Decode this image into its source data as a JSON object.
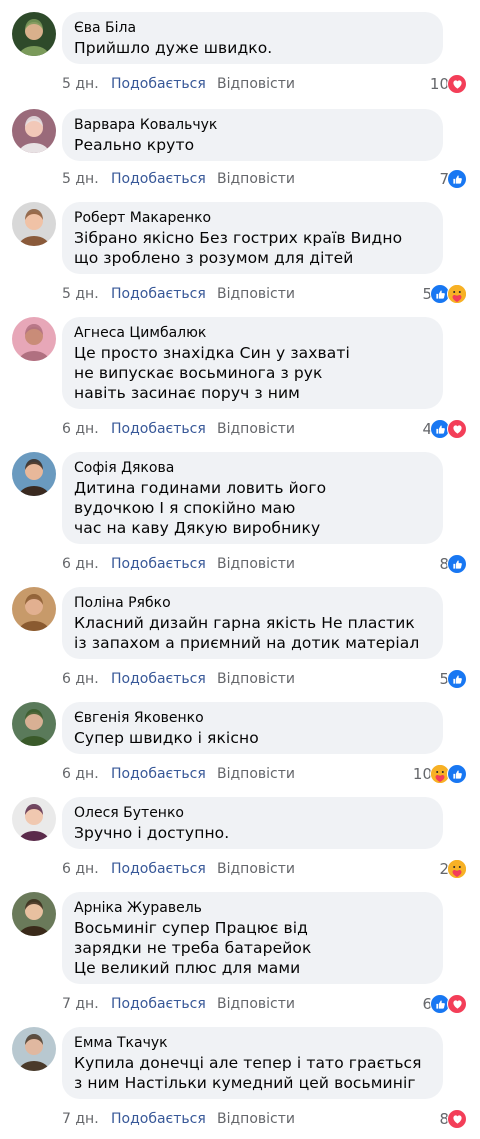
{
  "ui": {
    "like_label": "Подобається",
    "reply_label": "Відповісти"
  },
  "colors": {
    "like_blue": "#1877f2",
    "love_red": "#f33e58",
    "care_yellow": "#f7b125",
    "bubble_bg": "#f0f2f5",
    "meta_gray": "#65676b",
    "link_blue": "#385898"
  },
  "comments": [
    {
      "author": "Єва Біла",
      "lines": [
        "Прийшло дуже швидко."
      ],
      "time": "5 дн.",
      "count": "10",
      "reactions": [
        "love-icon"
      ]
    },
    {
      "author": "Варвара Ковальчук",
      "lines": [
        "Реально круто"
      ],
      "time": "5 дн.",
      "count": "7",
      "reactions": [
        "like-icon"
      ]
    },
    {
      "author": "Роберт Макаренко",
      "lines": [
        "Зібрано якісно Без гострих країв Видно",
        "що зроблено з розумом для дітей"
      ],
      "time": "5 дн.",
      "count": "5",
      "reactions": [
        "like-icon",
        "care-icon"
      ]
    },
    {
      "author": "Агнеса Цимбалюк",
      "lines": [
        "Це просто знахідка Син у захваті",
        "не випускає восьминога з рук",
        "навіть засинає поруч з ним"
      ],
      "time": "6 дн.",
      "count": "4",
      "reactions": [
        "like-icon",
        "love-icon"
      ]
    },
    {
      "author": "Софія Дякова",
      "lines": [
        "Дитина годинами ловить його",
        "вудочкою І я спокійно маю",
        "час на каву Дякую виробнику"
      ],
      "time": "6 дн.",
      "count": "8",
      "reactions": [
        "like-icon"
      ]
    },
    {
      "author": "Поліна Рябко",
      "lines": [
        "Класний дизайн гарна якість Не пластик",
        "із запахом а приємний на дотик матеріал"
      ],
      "time": "6 дн.",
      "count": "5",
      "reactions": [
        "like-icon"
      ]
    },
    {
      "author": "Євгенія Яковенко",
      "lines": [
        "Супер швидко і якісно"
      ],
      "time": "6 дн.",
      "count": "10",
      "reactions": [
        "care-icon",
        "like-icon"
      ]
    },
    {
      "author": "Олеся Бутенко",
      "lines": [
        "Зручно і доступно."
      ],
      "time": "6 дн.",
      "count": "2",
      "reactions": [
        "care-icon"
      ]
    },
    {
      "author": "Арніка Журавель",
      "lines": [
        "Восьминіг супер Працює від",
        "зарядки не треба батарейок",
        "Це великий плюс для мами"
      ],
      "time": "7 дн.",
      "count": "6",
      "reactions": [
        "like-icon",
        "love-icon"
      ]
    },
    {
      "author": "Емма Ткачук",
      "lines": [
        "Купила донечці але тепер і тато грається",
        "з ним Настільки кумедний цей восьминіг"
      ],
      "time": "7 дн.",
      "count": "8",
      "reactions": [
        "love-icon"
      ]
    }
  ]
}
